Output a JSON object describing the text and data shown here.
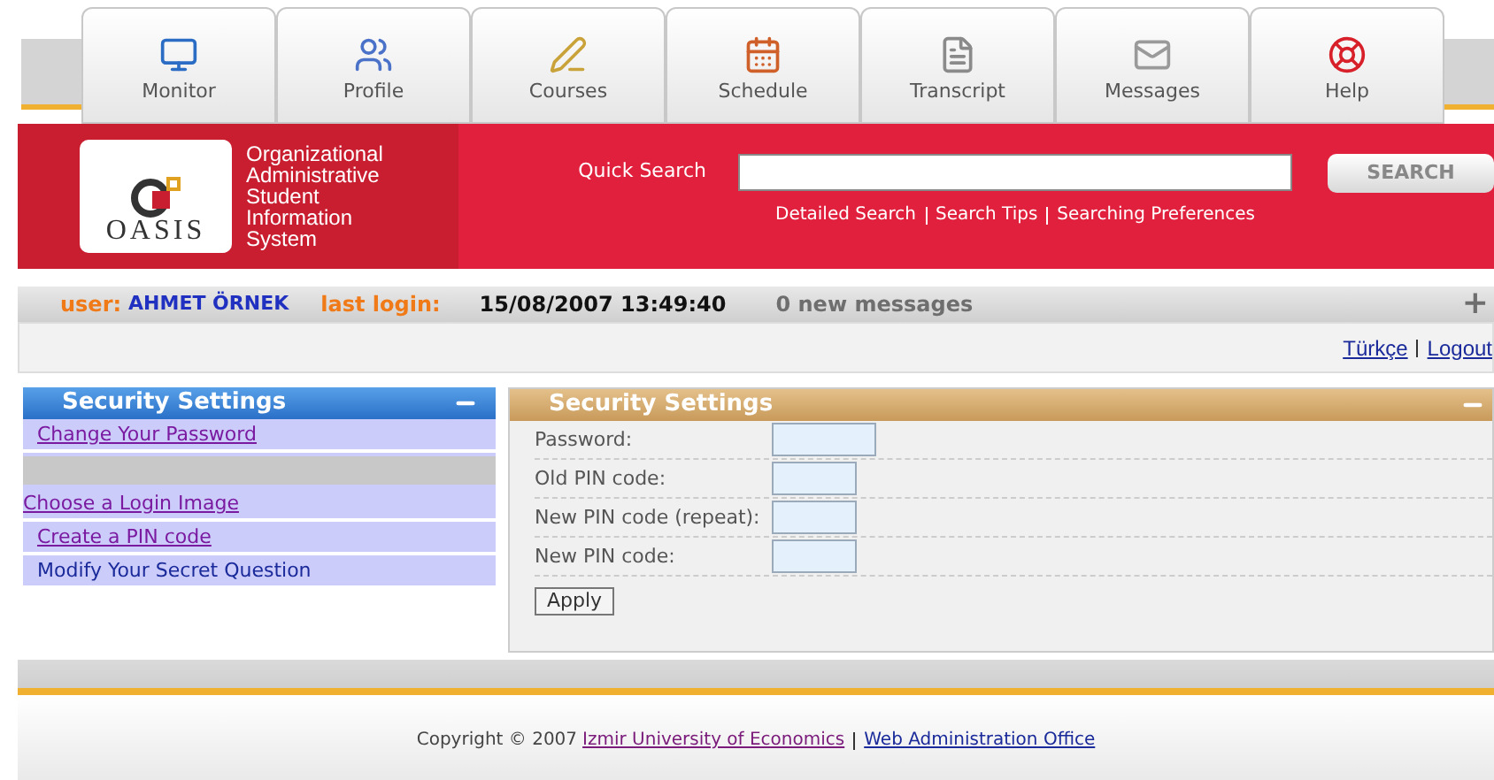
{
  "tabs": [
    {
      "label": "Monitor",
      "kind": "monitor"
    },
    {
      "label": "Profile",
      "kind": "profile"
    },
    {
      "label": "Courses",
      "kind": "courses"
    },
    {
      "label": "Schedule",
      "kind": "schedule"
    },
    {
      "label": "Transcript",
      "kind": "transcript"
    },
    {
      "label": "Messages",
      "kind": "messages"
    },
    {
      "label": "Help",
      "kind": "help"
    }
  ],
  "logo": {
    "mark": "OASIS",
    "lines": [
      "Organizational",
      "Administrative",
      "Student",
      "Information",
      "System"
    ]
  },
  "search": {
    "label": "Quick Search",
    "button": "SEARCH",
    "links": [
      "Detailed Search",
      "Search Tips",
      "Searching Preferences"
    ]
  },
  "user_bar": {
    "user_label": "user:",
    "user_name": "AHMET ÖRNEK",
    "login_label": "last login:",
    "login_time": "15/08/2007 13:49:40",
    "messages": "0 new messages",
    "expand": "+"
  },
  "language_links": [
    "Türkçe",
    "Logout"
  ],
  "sidebar": {
    "title": "Security Settings",
    "items": [
      {
        "label": "Change Your Password",
        "visited": true,
        "kind": "link"
      },
      {
        "kind": "blank"
      },
      {
        "label": "Choose a Login Image",
        "visited": true,
        "kind": "link"
      },
      {
        "label": "Create a PIN code",
        "visited": true,
        "kind": "link"
      },
      {
        "label": "Modify Your Secret Question",
        "visited": false,
        "kind": "link"
      }
    ]
  },
  "form": {
    "title": "Security Settings",
    "fields": [
      {
        "label": "Password:",
        "wide": true
      },
      {
        "label": "Old PIN code:",
        "wide": false
      },
      {
        "label": "New PIN code (repeat):",
        "wide": false
      },
      {
        "label": "New PIN code:",
        "wide": false
      }
    ],
    "button": "Apply"
  },
  "footer": {
    "copyright": "Copyright © 2007",
    "links": [
      "Izmir University of Economics",
      "Web Administration Office"
    ]
  }
}
